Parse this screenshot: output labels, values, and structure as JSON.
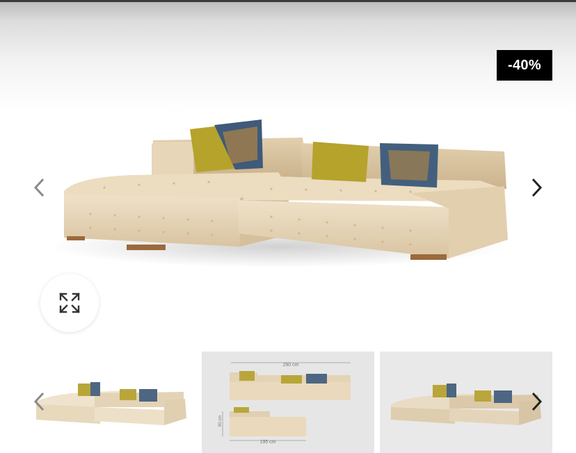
{
  "badge": {
    "discount": "-40%"
  },
  "icons": {
    "prev": "chevron-left-icon",
    "next": "chevron-right-icon",
    "zoom": "expand-arrows-icon"
  },
  "colors": {
    "badge_bg": "#000000",
    "badge_text": "#ffffff",
    "sofa_fabric": "#e6d3b5",
    "pillow_mustard": "#b5a32c"
  },
  "thumbnails": [
    {
      "kind": "product-photo"
    },
    {
      "kind": "dimension-drawing",
      "width_label": "290 cm",
      "depth_label": "195 cm",
      "side_label": "90 cm"
    },
    {
      "kind": "product-photo"
    }
  ]
}
